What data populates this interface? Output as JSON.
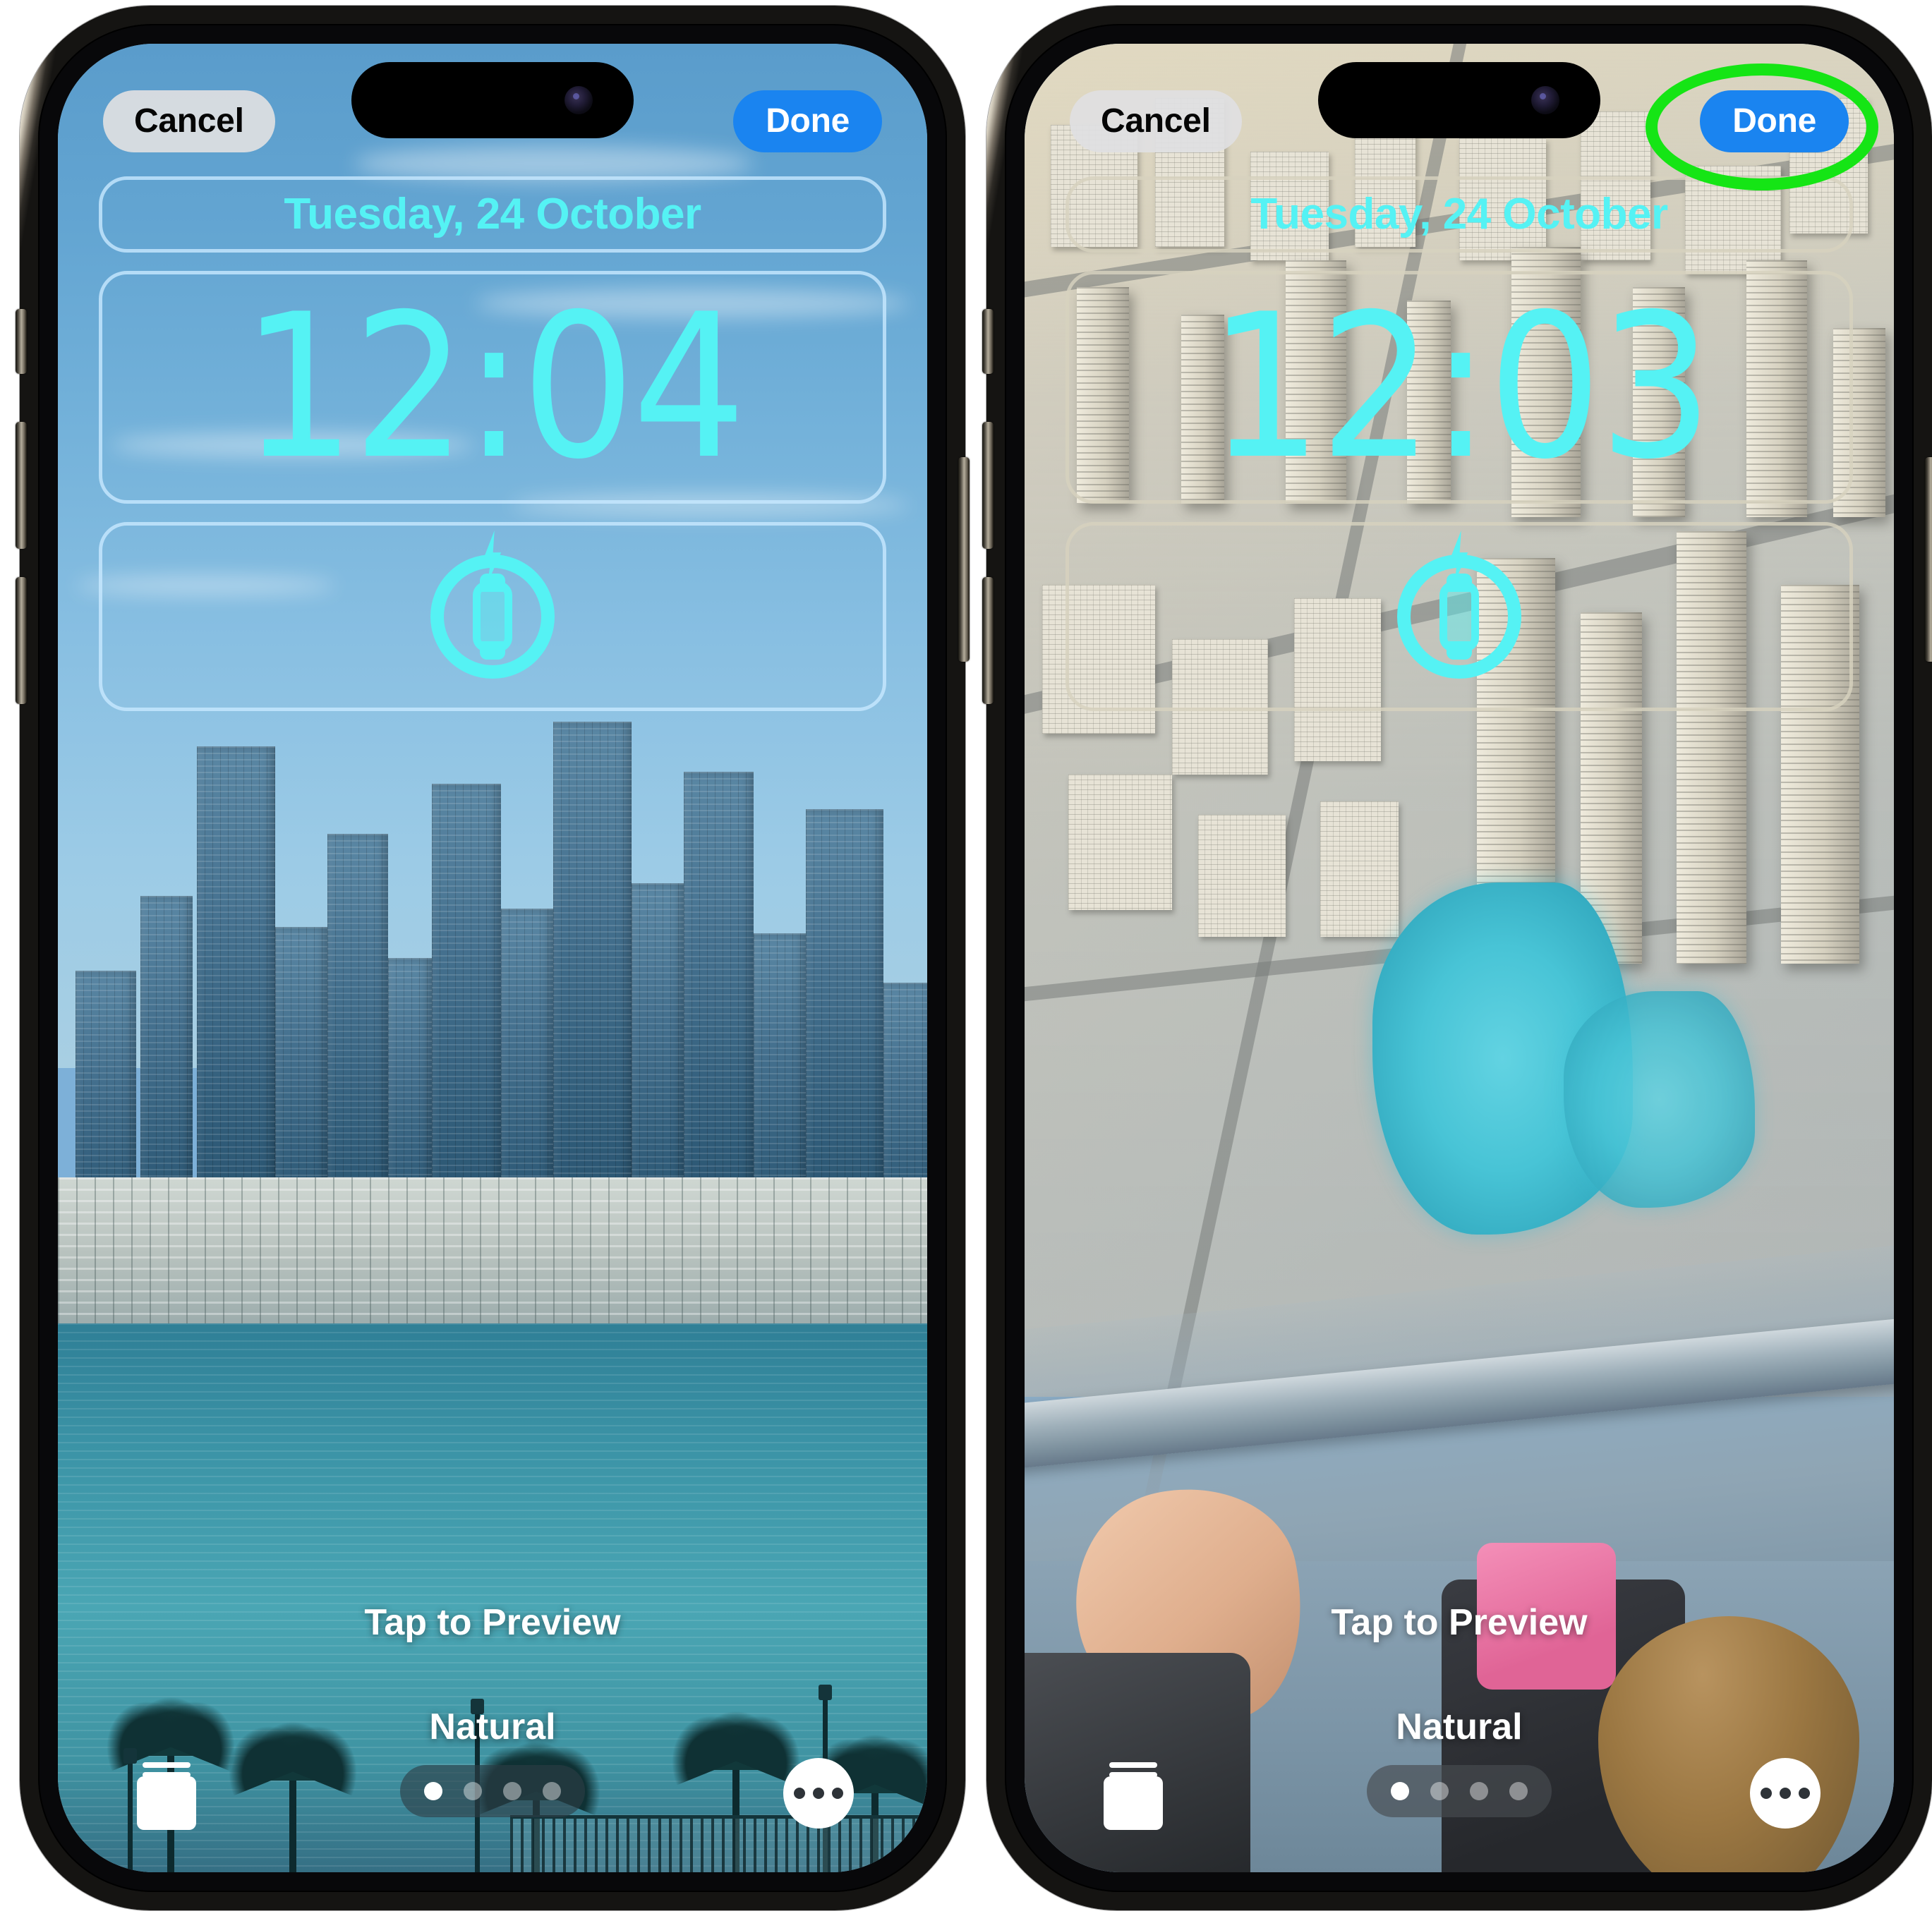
{
  "screens": [
    {
      "id": "left-phone",
      "name": "wallpaper-editor-dubai-downtown",
      "topbar": {
        "cancel_label": "Cancel",
        "done_label": "Done",
        "done_highlighted": false
      },
      "lockscreen": {
        "date": "Tuesday, 24 October",
        "time": "12:04",
        "widget_icon": "watch-charging-icon"
      },
      "bottom": {
        "tap_to_preview": "Tap to Preview",
        "style_label": "Natural",
        "photo_picker_icon": "photo-stack-icon",
        "more_icon": "ellipsis-icon",
        "page_count": 4,
        "active_page": 1
      }
    },
    {
      "id": "right-phone",
      "name": "wallpaper-editor-aerial-dubai",
      "topbar": {
        "cancel_label": "Cancel",
        "done_label": "Done",
        "done_highlighted": true
      },
      "lockscreen": {
        "date": "Tuesday, 24 October",
        "time": "12:03",
        "widget_icon": "watch-charging-icon"
      },
      "bottom": {
        "tap_to_preview": "Tap to Preview",
        "style_label": "Natural",
        "photo_picker_icon": "photo-stack-icon",
        "more_icon": "ellipsis-icon",
        "page_count": 4,
        "active_page": 1
      }
    }
  ],
  "colors": {
    "done_blue": "#1a84f0",
    "cancel_grey": "#e0e0e2",
    "clock_cyan": "#55f2f4",
    "highlight_green": "#15e515",
    "white": "#ffffff"
  }
}
